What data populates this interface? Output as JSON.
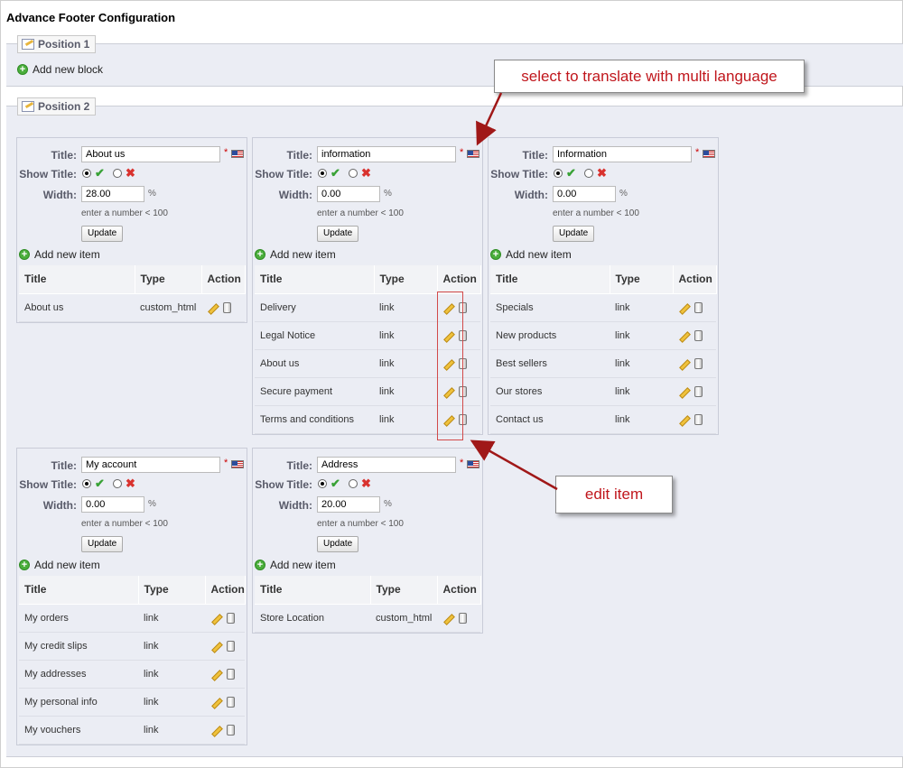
{
  "page_title": "Advance Footer Configuration",
  "position1": {
    "legend": "Position 1",
    "add_block": "Add new block"
  },
  "position2": {
    "legend": "Position 2"
  },
  "labels": {
    "title": "Title:",
    "show_title": "Show Title:",
    "width": "Width:",
    "required": "*",
    "percent": "%",
    "hint": "enter a number < 100",
    "update": "Update",
    "add_item": "Add new item",
    "col_title": "Title",
    "col_type": "Type",
    "col_action": "Action"
  },
  "blocks": [
    {
      "title": "About us",
      "width": "28.00",
      "items": [
        {
          "title": "About us",
          "type": "custom_html"
        }
      ]
    },
    {
      "title": "information",
      "width": "0.00",
      "items": [
        {
          "title": "Delivery",
          "type": "link"
        },
        {
          "title": "Legal Notice",
          "type": "link"
        },
        {
          "title": "About us",
          "type": "link"
        },
        {
          "title": "Secure payment",
          "type": "link"
        },
        {
          "title": "Terms and conditions",
          "type": "link"
        }
      ]
    },
    {
      "title": "Information",
      "width": "0.00",
      "items": [
        {
          "title": "Specials",
          "type": "link"
        },
        {
          "title": "New products",
          "type": "link"
        },
        {
          "title": "Best sellers",
          "type": "link"
        },
        {
          "title": "Our stores",
          "type": "link"
        },
        {
          "title": "Contact us",
          "type": "link"
        }
      ]
    },
    {
      "title": "My account",
      "width": "0.00",
      "items": [
        {
          "title": "My orders",
          "type": "link"
        },
        {
          "title": "My credit slips",
          "type": "link"
        },
        {
          "title": "My addresses",
          "type": "link"
        },
        {
          "title": "My personal info",
          "type": "link"
        },
        {
          "title": "My vouchers",
          "type": "link"
        }
      ]
    },
    {
      "title": "Address",
      "width": "20.00",
      "items": [
        {
          "title": "Store Location",
          "type": "custom_html"
        }
      ]
    }
  ],
  "callouts": {
    "translate": "select to translate with multi language",
    "edit": "edit item"
  },
  "colors": {
    "callout_text": "#c0161c",
    "arrow": "#a01818",
    "panel_bg": "#ebedf4"
  },
  "icons": [
    "edit-pencil-icon",
    "delete-bin-icon",
    "add-plus-icon",
    "us-flag-icon",
    "check-icon",
    "cross-icon",
    "fieldset-edit-icon"
  ]
}
